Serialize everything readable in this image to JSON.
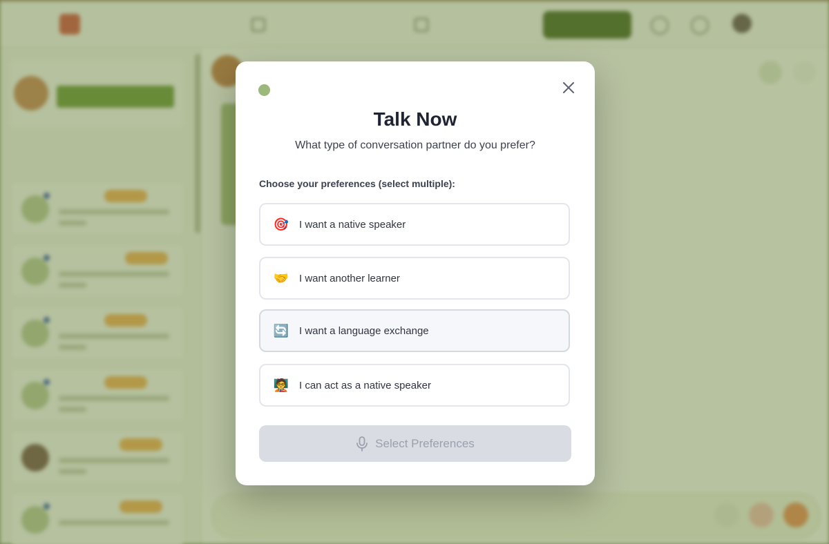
{
  "modal": {
    "title": "Talk Now",
    "subtitle": "What type of conversation partner do you prefer?",
    "preferences_label": "Choose your preferences (select multiple):",
    "options": [
      {
        "emoji": "🎯",
        "label": "I want a native speaker",
        "hovered": false
      },
      {
        "emoji": "🤝",
        "label": "I want another learner",
        "hovered": false
      },
      {
        "emoji": "🔄",
        "label": "I want a language exchange",
        "hovered": true
      },
      {
        "emoji": "🧑‍🏫",
        "label": "I can act as a native speaker",
        "hovered": false
      }
    ],
    "submit_label": "Select Preferences",
    "submit_disabled": true,
    "icons": {
      "close": "close-icon",
      "submit": "microphone-icon",
      "status": "status-dot"
    }
  },
  "colors": {
    "overlay": "#607830",
    "status_dot": "#9cb87a",
    "title": "#1f2433",
    "disabled_button": "#d9dce3",
    "disabled_text": "#9aa1ad"
  }
}
